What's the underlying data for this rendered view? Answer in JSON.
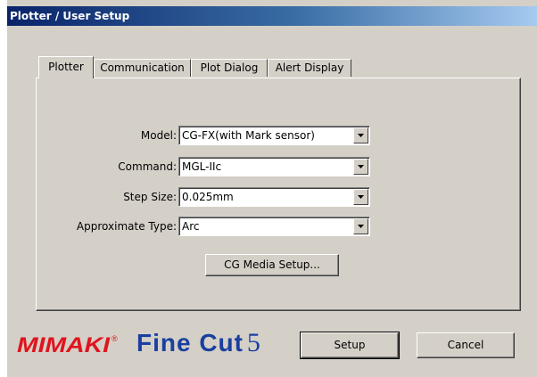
{
  "window": {
    "title": "Plotter / User Setup"
  },
  "tabs": [
    {
      "label": "Plotter",
      "active": true
    },
    {
      "label": "Communication",
      "active": false
    },
    {
      "label": "Plot Dialog",
      "active": false
    },
    {
      "label": "Alert Display",
      "active": false
    }
  ],
  "fields": {
    "model": {
      "label": "Model:",
      "value": "CG-FX(with Mark sensor)"
    },
    "command": {
      "label": "Command:",
      "value": "MGL-IIc"
    },
    "step_size": {
      "label": "Step Size:",
      "value": "0.025mm"
    },
    "approx_type": {
      "label": "Approximate Type:",
      "value": "Arc"
    }
  },
  "buttons": {
    "media_setup": "CG Media Setup...",
    "setup": "Setup",
    "cancel": "Cancel"
  },
  "branding": {
    "mimaki": "Mimaki",
    "mimaki_mark": "®",
    "product": "Fine Cut",
    "version": "5",
    "mimaki_color": "#e0141e",
    "finecut_color": "#1a3fa0"
  },
  "colors": {
    "dialog_bg": "#d4d0c8",
    "titlebar_start": "#0a246a",
    "titlebar_end": "#a6caf0"
  },
  "icons": {
    "dropdown": "chevron-down-icon"
  }
}
